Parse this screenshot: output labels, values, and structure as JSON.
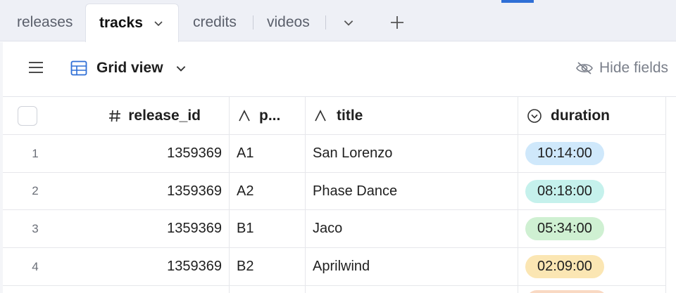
{
  "tabs": [
    {
      "label": "releases"
    },
    {
      "label": "tracks"
    },
    {
      "label": "credits"
    },
    {
      "label": "videos"
    }
  ],
  "toolbar": {
    "view_name": "Grid view",
    "hide_fields_label": "Hide fields"
  },
  "columns": [
    {
      "label": "release_id",
      "type_icon": "hash-icon"
    },
    {
      "label": "p...",
      "type_icon": "text-type-icon"
    },
    {
      "label": "title",
      "type_icon": "text-type-icon"
    },
    {
      "label": "duration",
      "type_icon": "select-type-icon"
    }
  ],
  "rows": [
    {
      "num": "1",
      "release_id": "1359369",
      "position": "A1",
      "title": "San Lorenzo",
      "duration": "10:14:00",
      "duration_color": "#cfe8fb"
    },
    {
      "num": "2",
      "release_id": "1359369",
      "position": "A2",
      "title": "Phase Dance",
      "duration": "08:18:00",
      "duration_color": "#c5f1ec"
    },
    {
      "num": "3",
      "release_id": "1359369",
      "position": "B1",
      "title": "Jaco",
      "duration": "05:34:00",
      "duration_color": "#cff0d2"
    },
    {
      "num": "4",
      "release_id": "1359369",
      "position": "B2",
      "title": "Aprilwind",
      "duration": "02:09:00",
      "duration_color": "#fbe6b3"
    }
  ],
  "colors": {
    "accent": "#2f6fd6",
    "partial_pill": "#f9d9c3"
  }
}
